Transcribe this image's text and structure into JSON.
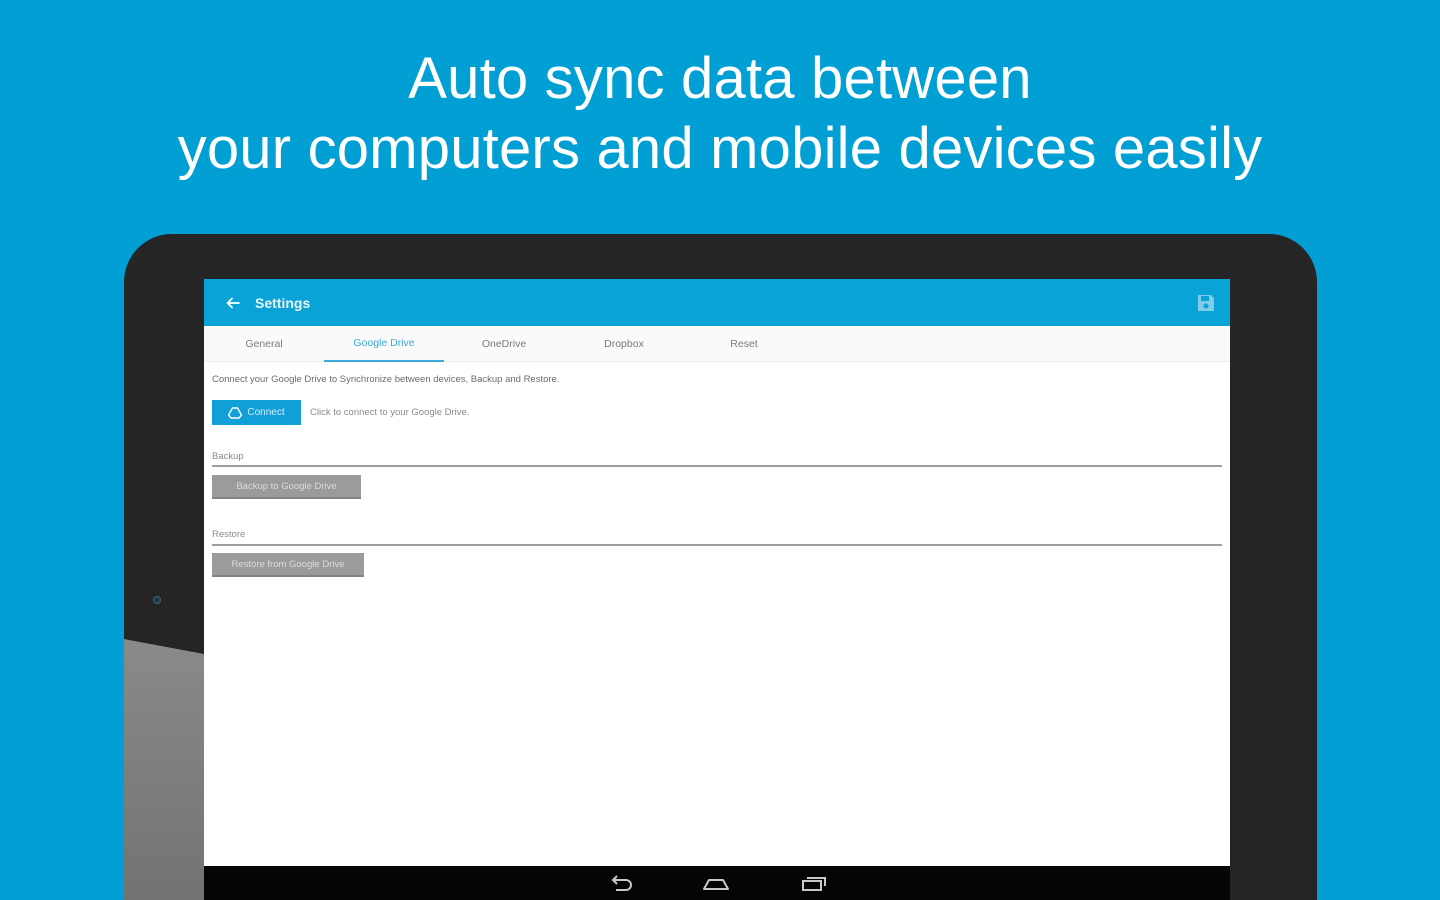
{
  "headline": {
    "line1": "Auto sync data between",
    "line2": "your computers and mobile devices easily"
  },
  "appbar": {
    "title": "Settings",
    "back_icon": "arrow-left-icon",
    "save_icon": "floppy-disk-icon"
  },
  "tabs": [
    {
      "label": "General",
      "active": false
    },
    {
      "label": "Google Drive",
      "active": true
    },
    {
      "label": "OneDrive",
      "active": false
    },
    {
      "label": "Dropbox",
      "active": false
    },
    {
      "label": "Reset",
      "active": false
    }
  ],
  "content": {
    "description": "Connect your Google Drive to Synchronize between devices, Backup and Restore.",
    "connect_label": "Connect",
    "connect_hint": "Click to connect to your Google Drive.",
    "backup_label": "Backup",
    "backup_button": "Backup to Google Drive",
    "restore_label": "Restore",
    "restore_button": "Restore from Google Drive"
  },
  "colors": {
    "background": "#019fd3",
    "appbar": "#0aa3d8",
    "accent": "#3fa9d9",
    "button_gray": "#9b9b9b"
  }
}
